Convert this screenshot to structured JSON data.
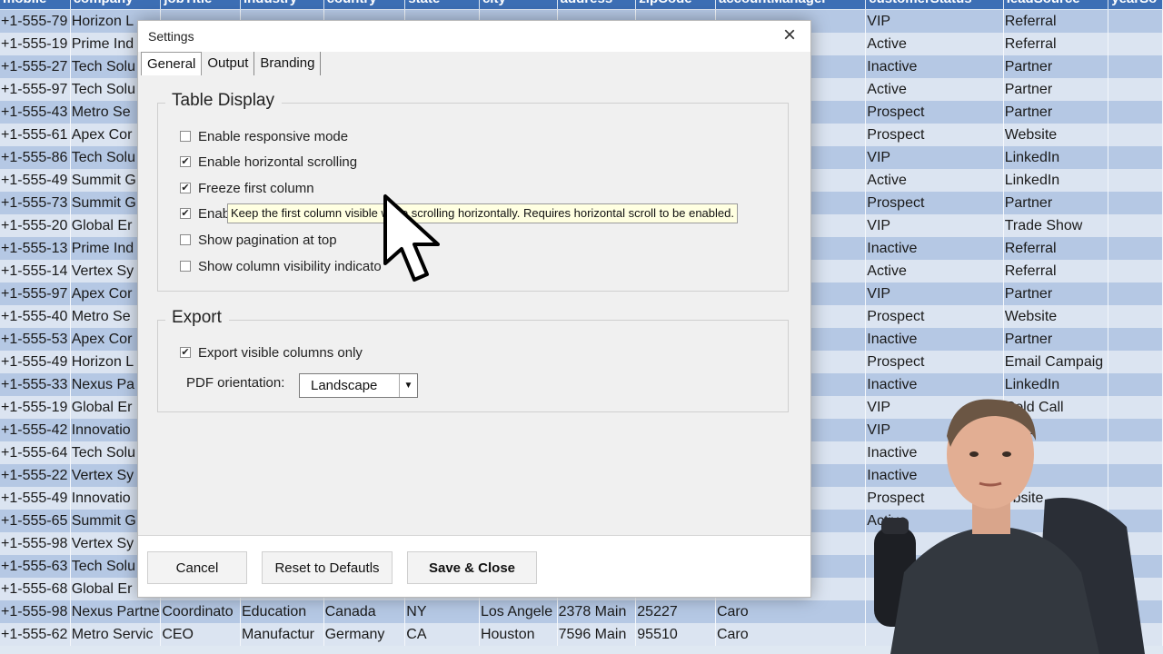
{
  "sheet": {
    "headers": [
      "mobile",
      "company",
      "jobTitle",
      "industry",
      "country",
      "state",
      "city",
      "address",
      "zipCode",
      "accountManager",
      "customerStatus",
      "leadSource",
      "yearSo"
    ],
    "rows": [
      [
        "+1-555-79",
        "Horizon L",
        "",
        "",
        "",
        "",
        "",
        "",
        "",
        "",
        "VIP",
        "Referral",
        ""
      ],
      [
        "+1-555-19",
        "Prime Ind",
        "",
        "",
        "",
        "",
        "",
        "",
        "",
        "",
        "Active",
        "Referral",
        ""
      ],
      [
        "+1-555-27",
        "Tech Solu",
        "",
        "",
        "",
        "",
        "",
        "",
        "",
        "",
        "Inactive",
        "Partner",
        ""
      ],
      [
        "+1-555-97",
        "Tech Solu",
        "",
        "",
        "",
        "",
        "",
        "",
        "",
        "",
        "Active",
        "Partner",
        ""
      ],
      [
        "+1-555-43",
        "Metro Se",
        "",
        "",
        "",
        "",
        "",
        "",
        "",
        "",
        "Prospect",
        "Partner",
        ""
      ],
      [
        "+1-555-61",
        "Apex Cor",
        "",
        "",
        "",
        "",
        "",
        "",
        "",
        "",
        "Prospect",
        "Website",
        ""
      ],
      [
        "+1-555-86",
        "Tech Solu",
        "",
        "",
        "",
        "",
        "",
        "",
        "",
        "",
        "VIP",
        "LinkedIn",
        ""
      ],
      [
        "+1-555-49",
        "Summit G",
        "",
        "",
        "",
        "",
        "",
        "",
        "",
        "",
        "Active",
        "LinkedIn",
        ""
      ],
      [
        "+1-555-73",
        "Summit G",
        "",
        "",
        "",
        "",
        "",
        "",
        "",
        "",
        "Prospect",
        "Partner",
        ""
      ],
      [
        "+1-555-20",
        "Global Er",
        "",
        "",
        "",
        "",
        "",
        "",
        "",
        "",
        "VIP",
        "Trade Show",
        ""
      ],
      [
        "+1-555-13",
        "Prime Ind",
        "",
        "",
        "",
        "",
        "",
        "",
        "",
        "",
        "Inactive",
        "Referral",
        ""
      ],
      [
        "+1-555-14",
        "Vertex Sy",
        "",
        "",
        "",
        "",
        "",
        "",
        "",
        "",
        "Active",
        "Referral",
        ""
      ],
      [
        "+1-555-97",
        "Apex Cor",
        "",
        "",
        "",
        "",
        "",
        "",
        "",
        "",
        "VIP",
        "Partner",
        ""
      ],
      [
        "+1-555-40",
        "Metro Se",
        "",
        "",
        "",
        "",
        "",
        "",
        "",
        "",
        "Prospect",
        "Website",
        ""
      ],
      [
        "+1-555-53",
        "Apex Cor",
        "",
        "",
        "",
        "",
        "",
        "",
        "",
        "",
        "Inactive",
        "Partner",
        ""
      ],
      [
        "+1-555-49",
        "Horizon L",
        "",
        "",
        "",
        "",
        "",
        "",
        "",
        "",
        "Prospect",
        "Email Campaig",
        ""
      ],
      [
        "+1-555-33",
        "Nexus Pa",
        "",
        "",
        "",
        "",
        "",
        "",
        "",
        "",
        "Inactive",
        "LinkedIn",
        ""
      ],
      [
        "+1-555-19",
        "Global Er",
        "",
        "",
        "",
        "",
        "",
        "",
        "",
        "",
        "VIP",
        "Cold Call",
        ""
      ],
      [
        "+1-555-42",
        "Innovatio",
        "",
        "",
        "",
        "",
        "",
        "",
        "",
        "",
        "VIP",
        "bsite",
        ""
      ],
      [
        "+1-555-64",
        "Tech Solu",
        "",
        "",
        "",
        "",
        "",
        "",
        "",
        "",
        "Inactive",
        "erral",
        ""
      ],
      [
        "+1-555-22",
        "Vertex Sy",
        "",
        "",
        "",
        "",
        "",
        "",
        "",
        "",
        "Inactive",
        "ner",
        ""
      ],
      [
        "+1-555-49",
        "Innovatio",
        "",
        "",
        "",
        "",
        "",
        "",
        "",
        "",
        "Prospect",
        "ebsite",
        ""
      ],
      [
        "+1-555-65",
        "Summit G",
        "",
        "",
        "",
        "",
        "",
        "",
        "",
        "",
        "Active",
        "",
        ""
      ],
      [
        "+1-555-98",
        "Vertex Sy",
        "",
        "",
        "",
        "",
        "",
        "",
        "",
        "",
        "",
        "",
        ""
      ],
      [
        "+1-555-63",
        "Tech Solu",
        "",
        "",
        "",
        "",
        "",
        "",
        "",
        "",
        "",
        "",
        ""
      ],
      [
        "+1-555-68",
        "Global Er",
        "",
        "",
        "",
        "",
        "",
        "",
        "",
        "",
        "",
        "",
        ""
      ],
      [
        "+1-555-98",
        "Nexus Partne",
        "Coordinato",
        "Education",
        "Canada",
        "NY",
        "Los Angele",
        "2378 Main",
        "25227",
        "Caro",
        "",
        "",
        ""
      ],
      [
        "+1-555-62",
        "Metro Servic",
        "CEO",
        "Manufactur",
        "Germany",
        "CA",
        "Houston",
        "7596 Main",
        "95510",
        "Caro",
        "",
        "",
        ""
      ]
    ]
  },
  "dialog": {
    "title": "Settings",
    "close_icon": "×",
    "tabs": [
      {
        "label": "General",
        "active": true
      },
      {
        "label": "Output",
        "active": false
      },
      {
        "label": "Branding",
        "active": false
      }
    ],
    "table_display": {
      "title": "Table Display",
      "options": [
        {
          "label": "Enable responsive mode",
          "checked": false
        },
        {
          "label": "Enable horizontal scrolling",
          "checked": true
        },
        {
          "label": "Freeze first column",
          "checked": true
        },
        {
          "label": "Enab",
          "checked": true
        },
        {
          "label": "Show pagination at top",
          "checked": false
        },
        {
          "label": "Show column visibility indicato",
          "checked": false
        }
      ]
    },
    "export": {
      "title": "Export",
      "visible_only_label": "Export visible columns only",
      "visible_only_checked": true,
      "orientation_label": "PDF orientation:",
      "orientation_value": "Landscape"
    },
    "tooltip": "Keep the first column visible while scrolling horizontally. Requires horizontal scroll to be enabled.",
    "buttons": {
      "cancel": "Cancel",
      "reset": "Reset to Defautls",
      "save": "Save & Close"
    }
  },
  "colors": {
    "header_blue": "#3d6fb5",
    "row_dark": "#b5c8e4",
    "row_light": "#dbe4f1",
    "tooltip_bg": "#ffffe1"
  }
}
